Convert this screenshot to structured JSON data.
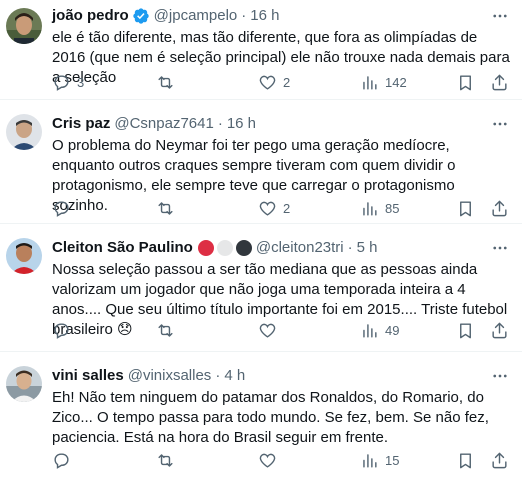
{
  "colors": {
    "text_primary": "#0f1419",
    "text_secondary": "#536471",
    "verified_blue": "#1d9bf0",
    "divider": "#eff3f4"
  },
  "tweets": [
    {
      "name": "joão pedro",
      "handle": "@jpcampelo",
      "separator": "·",
      "time": "16 h",
      "verified": true,
      "text": "ele é tão diferente, mas tão diferente, que fora as olimpíadas de 2016 (que nem é seleção principal) ele não trouxe nada demais para a seleção",
      "replies": "3",
      "retweets": "",
      "likes": "2",
      "views": "142"
    },
    {
      "name": "Cris paz",
      "handle": "@Csnpaz7641",
      "separator": "·",
      "time": "16 h",
      "verified": false,
      "text": "O problema do Neymar foi ter pego uma geração medíocre, enquanto outros craques sempre tiveram com quem dividir o protagonismo, ele sempre teve que carregar o protagonismo sozinho.",
      "replies": "",
      "retweets": "",
      "likes": "2",
      "views": "85"
    },
    {
      "name": "Cleiton São Paulino",
      "handle": "@cleiton23tri",
      "separator": "·",
      "time": "5 h",
      "verified": false,
      "text": "Nossa seleção passou a ser tão mediana que as pessoas ainda valorizam um jogador que não joga uma temporada inteira a 4 anos.... Que seu último título importante foi em 2015.... Triste futebol brasileiro 😞",
      "replies": "",
      "retweets": "",
      "likes": "",
      "views": "49"
    },
    {
      "name": "vini salles",
      "handle": "@vinixsalles",
      "separator": "·",
      "time": "4 h",
      "verified": false,
      "text": "Eh! Não tem ninguem do patamar dos Ronaldos, do Romario, do Zico... O tempo passa para todo mundo. Se fez, bem. Se não fez, paciencia. Está na hora do Brasil seguir em frente.",
      "replies": "",
      "retweets": "",
      "likes": "",
      "views": "15"
    }
  ]
}
